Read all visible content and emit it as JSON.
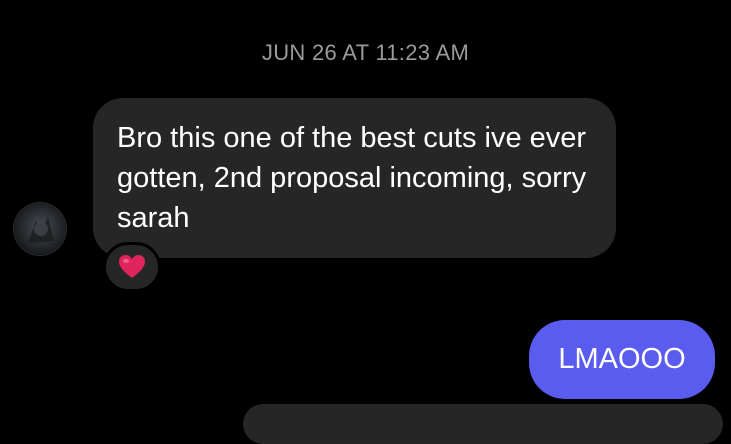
{
  "thread": {
    "timestamp": "JUN 26 AT 11:23 AM",
    "messages": [
      {
        "direction": "incoming",
        "text": "Bro  this one of the best cuts ive ever gotten, 2nd proposal incoming, sorry sarah",
        "reaction": "red-heart-icon"
      },
      {
        "direction": "outgoing",
        "text": "LMAOOO"
      }
    ]
  },
  "colors": {
    "background": "#000000",
    "incoming_bubble": "#262626",
    "outgoing_bubble": "#5a5cf0",
    "timestamp_text": "#9a9a9a",
    "reaction_heart": "#e0245e"
  }
}
